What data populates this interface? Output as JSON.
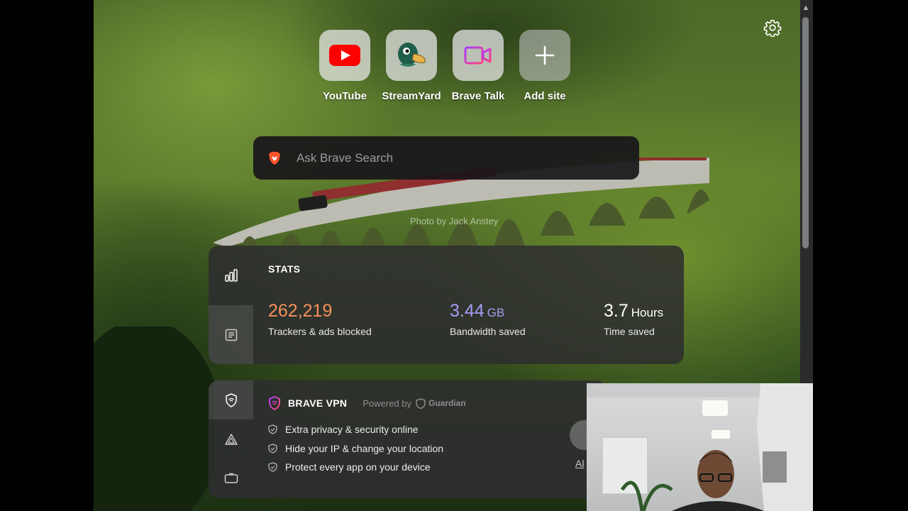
{
  "top_sites": [
    {
      "label": "YouTube",
      "icon": "youtube-icon"
    },
    {
      "label": "StreamYard",
      "icon": "streamyard-duck-icon"
    },
    {
      "label": "Brave Talk",
      "icon": "brave-talk-camera-icon"
    },
    {
      "label": "Add site",
      "icon": "plus-icon"
    }
  ],
  "search": {
    "placeholder": "Ask Brave Search"
  },
  "photo_credit": "Photo by Jack Anstey",
  "stats": {
    "title": "STATS",
    "trackers": {
      "value": "262,219",
      "label": "Trackers & ads blocked",
      "color": "#f6915d"
    },
    "bandwidth": {
      "value": "3.44",
      "unit": "GB",
      "label": "Bandwidth saved",
      "color": "#a89cf7"
    },
    "time": {
      "value": "3.7",
      "unit": "Hours",
      "label": "Time saved",
      "color": "#ffffff"
    }
  },
  "vpn": {
    "title": "BRAVE VPN",
    "powered_by": "Powered by",
    "partner": "Guardian",
    "features": [
      "Extra privacy & security online",
      "Hide your IP & change your location",
      "Protect every app on your device"
    ],
    "link_text": "Al"
  }
}
